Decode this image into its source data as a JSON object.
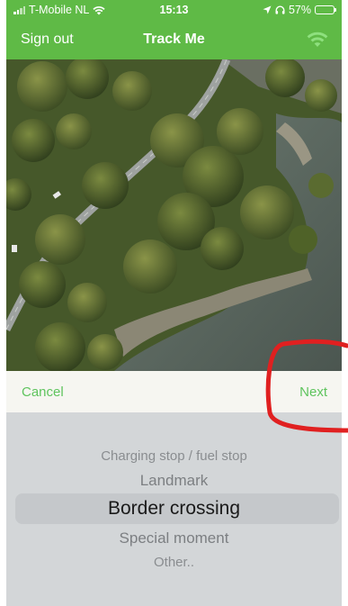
{
  "status_bar": {
    "carrier": "T-Mobile NL",
    "time": "15:13",
    "battery": "57%",
    "battery_level": 0.57
  },
  "nav": {
    "left_label": "Sign out",
    "title": "Track Me",
    "right_icon": "wifi-icon"
  },
  "photo": {
    "icon": "aerial-landscape-image"
  },
  "picker_toolbar": {
    "cancel_label": "Cancel",
    "next_label": "Next"
  },
  "picker": {
    "options": [
      "Charging stop / fuel stop",
      "Landmark",
      "Border crossing",
      "Special moment",
      "Other.."
    ],
    "selected": "Border crossing"
  },
  "colors": {
    "brand_green": "#5fba46",
    "button_green": "#5fc45e",
    "annotation_red": "#e02020"
  }
}
